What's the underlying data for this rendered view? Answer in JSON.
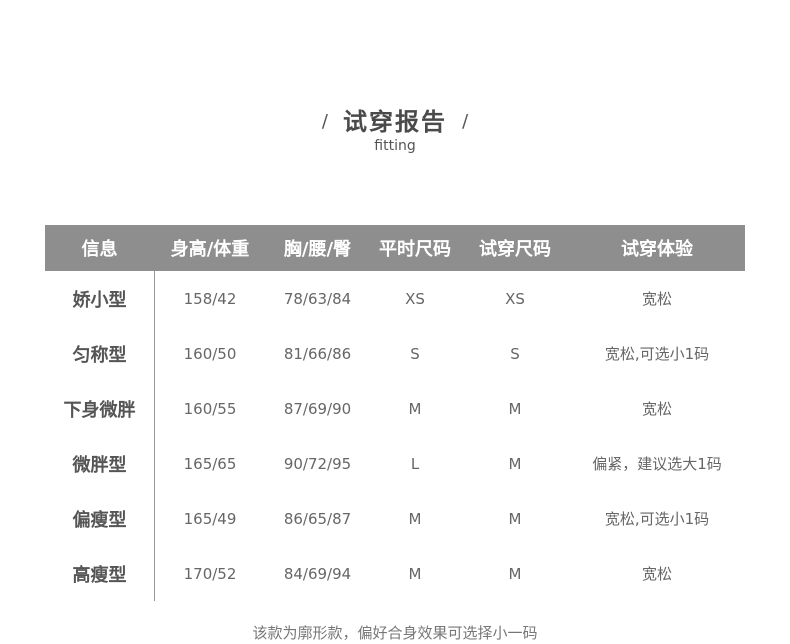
{
  "header": {
    "slash_left": "/",
    "title": "试穿报告",
    "slash_right": "/",
    "subtitle": "fitting"
  },
  "table": {
    "columns": [
      "信息",
      "身高/体重",
      "胸/腰/臀",
      "平时尺码",
      "试穿尺码",
      "试穿体验"
    ],
    "rows": [
      [
        "娇小型",
        "158/42",
        "78/63/84",
        "XS",
        "XS",
        "宽松"
      ],
      [
        "匀称型",
        "160/50",
        "81/66/86",
        "S",
        "S",
        "宽松,可选小1码"
      ],
      [
        "下身微胖",
        "160/55",
        "87/69/90",
        "M",
        "M",
        "宽松"
      ],
      [
        "微胖型",
        "165/65",
        "90/72/95",
        "L",
        "M",
        "偏紧，建议选大1码"
      ],
      [
        "偏瘦型",
        "165/49",
        "86/65/87",
        "M",
        "M",
        "宽松,可选小1码"
      ],
      [
        "高瘦型",
        "170/52",
        "84/69/94",
        "M",
        "M",
        "宽松"
      ]
    ]
  },
  "footnote": "该款为廓形款，偏好合身效果可选择小一码",
  "colors": {
    "header_bg": "#8e8e8e",
    "header_text": "#ffffff",
    "body_text": "#666666"
  }
}
